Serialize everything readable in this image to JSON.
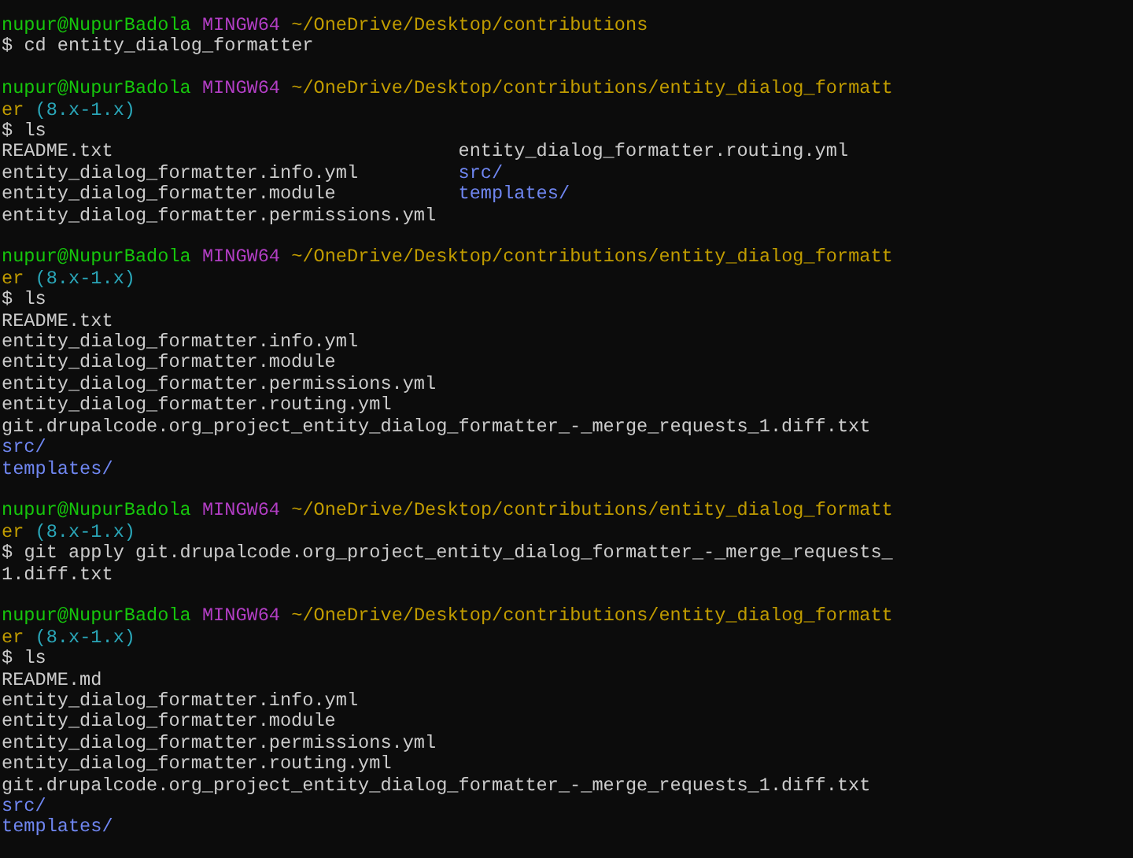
{
  "terminal": {
    "sessions": [
      {
        "prompt": {
          "user": "nupur@NupurBadola",
          "system": "MINGW64",
          "path": "~/OneDrive/Desktop/contributions"
        },
        "symbol": "$",
        "command": "cd entity_dialog_formatter"
      },
      {
        "prompt": {
          "user": "nupur@NupurBadola",
          "system": "MINGW64",
          "path": "~/OneDrive/Desktop/contributions/entity_dialog_formatter",
          "branch": "(8.x-1.x)"
        },
        "symbol": "$",
        "command": "ls",
        "output": {
          "columns": [
            [
              {
                "name": "README.txt",
                "kind": "file"
              },
              {
                "name": "entity_dialog_formatter.info.yml",
                "kind": "file"
              },
              {
                "name": "entity_dialog_formatter.module",
                "kind": "file"
              },
              {
                "name": "entity_dialog_formatter.permissions.yml",
                "kind": "file"
              }
            ],
            [
              {
                "name": "entity_dialog_formatter.routing.yml",
                "kind": "file"
              },
              {
                "name": "src/",
                "kind": "directory"
              },
              {
                "name": "templates/",
                "kind": "directory"
              }
            ]
          ]
        }
      },
      {
        "prompt": {
          "user": "nupur@NupurBadola",
          "system": "MINGW64",
          "path": "~/OneDrive/Desktop/contributions/entity_dialog_formatter",
          "branch": "(8.x-1.x)"
        },
        "symbol": "$",
        "command": "ls",
        "output": {
          "entries": [
            {
              "name": "README.txt",
              "kind": "file"
            },
            {
              "name": "entity_dialog_formatter.info.yml",
              "kind": "file"
            },
            {
              "name": "entity_dialog_formatter.module",
              "kind": "file"
            },
            {
              "name": "entity_dialog_formatter.permissions.yml",
              "kind": "file"
            },
            {
              "name": "entity_dialog_formatter.routing.yml",
              "kind": "file"
            },
            {
              "name": "git.drupalcode.org_project_entity_dialog_formatter_-_merge_requests_1.diff.txt",
              "kind": "file"
            },
            {
              "name": "src/",
              "kind": "directory"
            },
            {
              "name": "templates/",
              "kind": "directory"
            }
          ]
        }
      },
      {
        "prompt": {
          "user": "nupur@NupurBadola",
          "system": "MINGW64",
          "path": "~/OneDrive/Desktop/contributions/entity_dialog_formatter",
          "branch": "(8.x-1.x)"
        },
        "symbol": "$",
        "command": "git apply git.drupalcode.org_project_entity_dialog_formatter_-_merge_requests_1.diff.txt"
      },
      {
        "prompt": {
          "user": "nupur@NupurBadola",
          "system": "MINGW64",
          "path": "~/OneDrive/Desktop/contributions/entity_dialog_formatter",
          "branch": "(8.x-1.x)"
        },
        "symbol": "$",
        "command": "ls",
        "output": {
          "entries": [
            {
              "name": "README.md",
              "kind": "file"
            },
            {
              "name": "entity_dialog_formatter.info.yml",
              "kind": "file"
            },
            {
              "name": "entity_dialog_formatter.module",
              "kind": "file"
            },
            {
              "name": "entity_dialog_formatter.permissions.yml",
              "kind": "file"
            },
            {
              "name": "entity_dialog_formatter.routing.yml",
              "kind": "file"
            },
            {
              "name": "git.drupalcode.org_project_entity_dialog_formatter_-_merge_requests_1.diff.txt",
              "kind": "file"
            },
            {
              "name": "src/",
              "kind": "directory"
            },
            {
              "name": "templates/",
              "kind": "directory"
            }
          ]
        }
      }
    ]
  }
}
